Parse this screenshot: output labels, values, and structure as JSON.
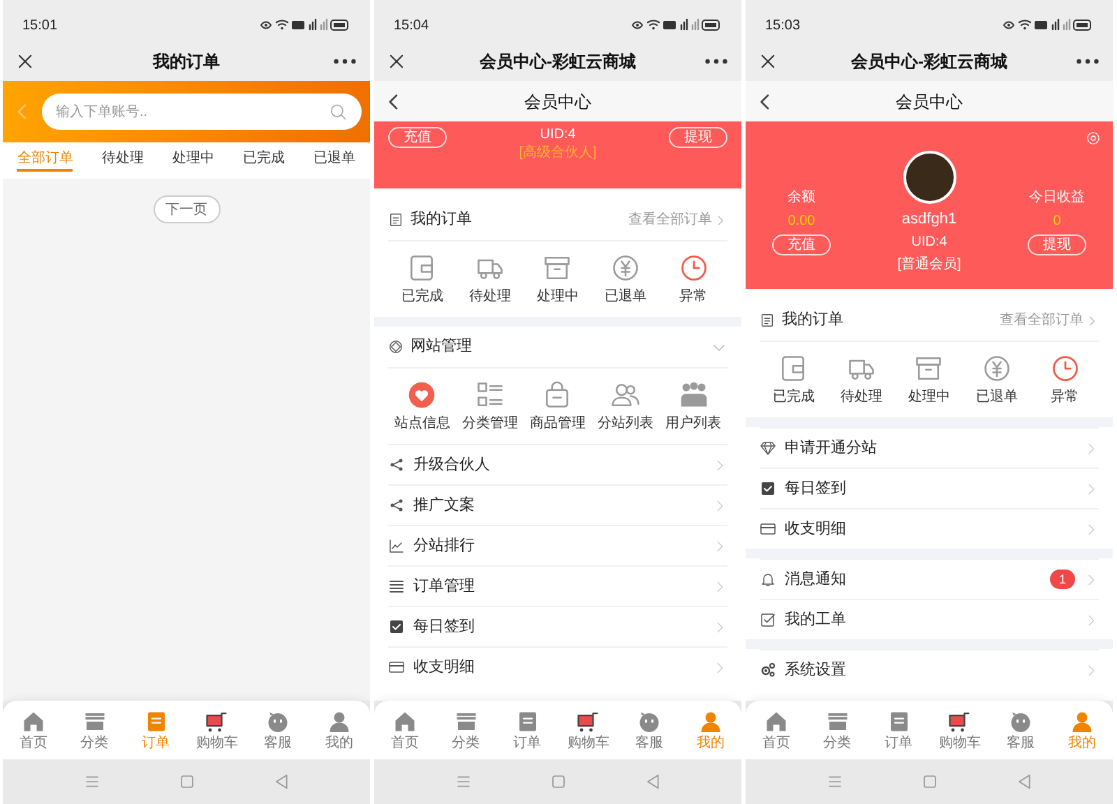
{
  "phones": [
    {
      "kind": "orders",
      "time": "15:01",
      "title": "我的订单",
      "search": {
        "placeholder": "输入下单账号.."
      },
      "tabs": [
        {
          "label": "全部订单",
          "selected": true
        },
        {
          "label": "待处理",
          "selected": false
        },
        {
          "label": "处理中",
          "selected": false
        },
        {
          "label": "已完成",
          "selected": false
        },
        {
          "label": "已退单",
          "selected": false
        }
      ],
      "pager": "下一页",
      "tab_bar": [
        {
          "label": "首页",
          "selected": false
        },
        {
          "label": "分类",
          "selected": false
        },
        {
          "label": "订单",
          "selected": true
        },
        {
          "label": "购物车",
          "selected": false
        },
        {
          "label": "客服",
          "selected": false
        },
        {
          "label": "我的",
          "selected": false
        }
      ]
    },
    {
      "kind": "member",
      "time": "15:04",
      "title": "会员中心-彩虹云商城",
      "subtitle": "会员中心",
      "header": {
        "kind": "scrolled",
        "recharge": "充值",
        "uid": "UID:4",
        "level": "[高级合伙人]",
        "withdraw": "提现"
      },
      "sections": [
        {
          "title": "我的订单",
          "link": "查看全部订单",
          "items": [
            "已完成",
            "待处理",
            "处理中",
            "已退单",
            "异常"
          ]
        },
        {
          "title": "网站管理",
          "expanded": true,
          "items": [
            "站点信息",
            "分类管理",
            "商品管理",
            "分站列表",
            "用户列表"
          ],
          "rows": [
            {
              "label": "升级合伙人"
            },
            {
              "label": "推广文案"
            },
            {
              "label": "分站排行"
            },
            {
              "label": "订单管理"
            },
            {
              "label": "每日签到"
            },
            {
              "label": "收支明细"
            }
          ]
        }
      ],
      "tab_bar": [
        {
          "label": "首页",
          "selected": false
        },
        {
          "label": "分类",
          "selected": false
        },
        {
          "label": "订单",
          "selected": false
        },
        {
          "label": "购物车",
          "selected": false
        },
        {
          "label": "客服",
          "selected": false
        },
        {
          "label": "我的",
          "selected": true
        }
      ]
    },
    {
      "kind": "member",
      "time": "15:03",
      "title": "会员中心-彩虹云商城",
      "subtitle": "会员中心",
      "header": {
        "kind": "full",
        "balance_label": "余额",
        "balance": "0.00",
        "recharge": "充值",
        "username": "asdfgh1",
        "uid": "UID:4",
        "level": "[普通会员]",
        "income_label": "今日收益",
        "income": "0",
        "withdraw": "提现"
      },
      "sections": [
        {
          "title": "我的订单",
          "link": "查看全部订单",
          "items": [
            "已完成",
            "待处理",
            "处理中",
            "已退单",
            "异常"
          ]
        },
        {
          "rows": [
            {
              "label": "申请开通分站"
            },
            {
              "label": "每日签到"
            },
            {
              "label": "收支明细"
            }
          ]
        },
        {
          "rows": [
            {
              "label": "消息通知",
              "badge": "1"
            },
            {
              "label": "我的工单"
            }
          ]
        },
        {
          "rows": [
            {
              "label": "系统设置"
            }
          ]
        }
      ],
      "tab_bar": [
        {
          "label": "首页",
          "selected": false
        },
        {
          "label": "分类",
          "selected": false
        },
        {
          "label": "订单",
          "selected": false
        },
        {
          "label": "购物车",
          "selected": false
        },
        {
          "label": "客服",
          "selected": false
        },
        {
          "label": "我的",
          "selected": true
        }
      ]
    }
  ]
}
